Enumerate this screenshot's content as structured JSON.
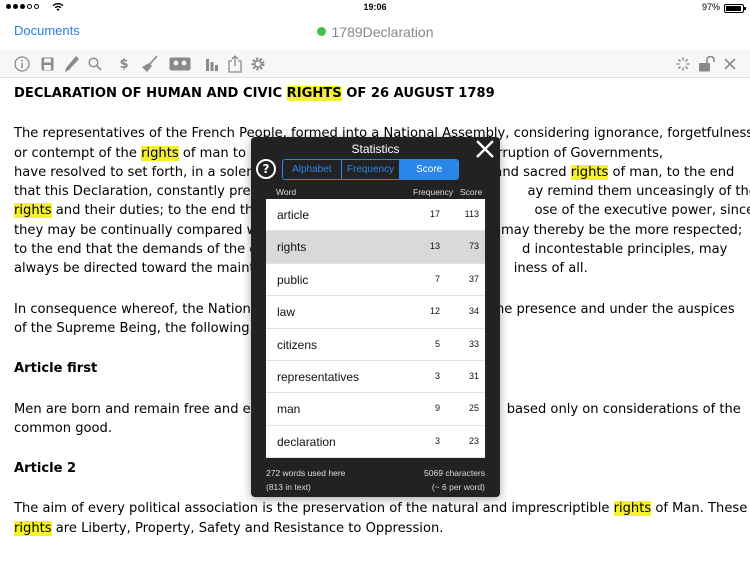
{
  "status": {
    "time": "19:06",
    "battery": "97%"
  },
  "nav": {
    "back": "Documents",
    "title": "1789Declaration"
  },
  "toolbar": {
    "left_icons": [
      "info-icon",
      "save-icon",
      "pencil-icon",
      "search-icon",
      "currency-icon",
      "broom-icon",
      "tape-icon",
      "bar-chart-icon",
      "share-icon",
      "gear-icon"
    ],
    "right_icons": [
      "loading-icon",
      "unlock-icon",
      "close-icon"
    ]
  },
  "doc": {
    "title": [
      "DECLARATION OF HUMAN AND CIVIC ",
      "RIGHTS",
      " OF 26 AUGUST 1789"
    ],
    "p1": {
      "l1": "The representatives of the French People, formed into a National Assembly, considering ignorance, forgetfulness",
      "l2a": "or contempt of the ",
      "l2b": "rights",
      "l2c": " of man to be",
      "l2d": "and the corruption of Governments,",
      "l3a": "have resolved to set forth, in a solemn",
      "l3b": "and sacred ",
      "l3c": "rights",
      "l3d": " of man, to the end",
      "l4a": "that this Declaration, constantly prese",
      "l4b": "ay remind them unceasingly of their",
      "l5a": "rights",
      "l5b": " and their duties; to the end that",
      "l5c": "ose of the executive power, since",
      "l6a": "they may be continually compared wi",
      "l6b": "may thereby be the more respected;",
      "l7a": "to the end that the demands of the citi",
      "l7b": "d incontestable principles, may",
      "l8a": "always be directed toward the mainte",
      "l8b": "iness of all."
    },
    "p2": {
      "l1a": "In consequence whereof, the Nationa",
      "l1b": "the presence and under the auspices",
      "l2a": "of the Supreme Being, the following ",
      "l2b": "R"
    },
    "h1": "Article first",
    "p3": {
      "l1a": "Men are born and remain free and e",
      "l1b": "based only on considerations of the",
      "l2": "common good."
    },
    "h2": "Article 2",
    "p4": {
      "l1a": "The aim of every political association is the preservation of the natural and imprescriptible ",
      "l1b": "rights",
      "l1c": " of Man. These",
      "l2a": "rights",
      "l2b": " are Liberty, Property, Safety and Resistance to Oppression."
    }
  },
  "popover": {
    "title": "Statistics",
    "tabs": [
      "Alphabet",
      "Frequency",
      "Score"
    ],
    "active_tab": "Score",
    "headers": {
      "word": "Word",
      "frequency": "Frequency",
      "score": "Score"
    },
    "rows": [
      {
        "word": "article",
        "frequency": "17",
        "score": "113"
      },
      {
        "word": "rights",
        "frequency": "13",
        "score": "73"
      },
      {
        "word": "public",
        "frequency": "7",
        "score": "37"
      },
      {
        "word": "law",
        "frequency": "12",
        "score": "34"
      },
      {
        "word": "citizens",
        "frequency": "5",
        "score": "33"
      },
      {
        "word": "representatives",
        "frequency": "3",
        "score": "31"
      },
      {
        "word": "man",
        "frequency": "9",
        "score": "25"
      },
      {
        "word": "declaration",
        "frequency": "3",
        "score": "23"
      }
    ],
    "selected_row": 1,
    "footer": {
      "words": "272 words used here",
      "words_sub": "(813 in text)",
      "chars": "5069 characters",
      "chars_sub": "(~ 6 per word)"
    }
  },
  "colors": {
    "accent": "#2a7fd4",
    "highlight": "#f5f12a",
    "popover_bg": "#222222",
    "online_dot": "#3fc441"
  }
}
